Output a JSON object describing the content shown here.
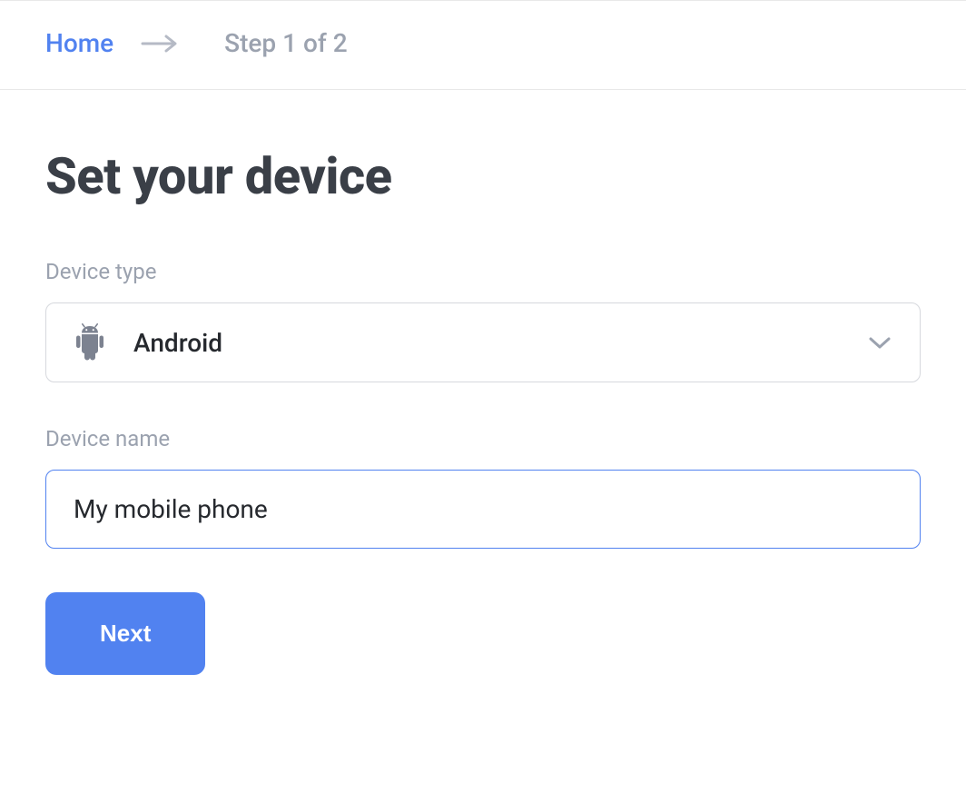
{
  "breadcrumb": {
    "home_label": "Home",
    "step_label": "Step 1 of 2"
  },
  "page": {
    "title": "Set your device"
  },
  "form": {
    "device_type_label": "Device type",
    "device_type_value": "Android",
    "device_name_label": "Device name",
    "device_name_value": "My mobile phone"
  },
  "actions": {
    "next_label": "Next"
  }
}
